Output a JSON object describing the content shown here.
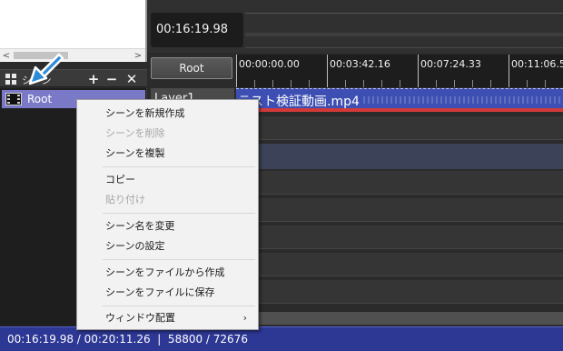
{
  "scene_panel": {
    "title": "シーン",
    "add_label": "+",
    "remove_label": "−",
    "close_label": "✕",
    "items": [
      {
        "label": "Root"
      }
    ]
  },
  "timeline": {
    "current_time": "00:16:19.98",
    "scene_button": "Root",
    "ruler_labels": [
      "00:00:00.00",
      "00:03:42.16",
      "00:07:24.33",
      "00:11:06.5"
    ],
    "layers": [
      {
        "label": "Layer1",
        "clip_name": "テスト検証動画.mp4"
      }
    ]
  },
  "status_bar": {
    "text": "00:16:19.98 / 00:20:11.26  |  58800 / 72676"
  },
  "context_menu": {
    "groups": [
      [
        {
          "label": "シーンを新規作成",
          "enabled": true
        },
        {
          "label": "シーンを削除",
          "enabled": false
        },
        {
          "label": "シーンを複製",
          "enabled": true
        }
      ],
      [
        {
          "label": "コピー",
          "enabled": true
        },
        {
          "label": "貼り付け",
          "enabled": false
        }
      ],
      [
        {
          "label": "シーン名を変更",
          "enabled": true
        },
        {
          "label": "シーンの設定",
          "enabled": true
        }
      ],
      [
        {
          "label": "シーンをファイルから作成",
          "enabled": true
        },
        {
          "label": "シーンをファイルに保存",
          "enabled": true
        }
      ],
      [
        {
          "label": "ウィンドウ配置",
          "enabled": true,
          "submenu": true
        }
      ]
    ]
  },
  "icons": {
    "scroll_left": "chevron-left-icon",
    "scroll_right": "chevron-right-icon",
    "scene_grid": "grid-icon",
    "scene_item": "film-icon",
    "cursor": "blue-arrow-icon",
    "submenu": "chevron-right-icon"
  },
  "colors": {
    "selection": "#7a79c8",
    "clip": "#3d4fb2",
    "status_bar": "#2d3794",
    "cursor": "#2e8bd8"
  }
}
